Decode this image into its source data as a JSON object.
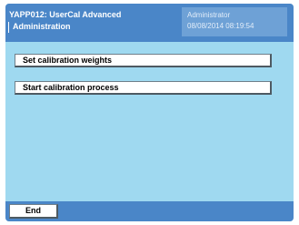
{
  "header": {
    "title_line1": "YAPP012: UserCal Advanced",
    "title_line2": "Administration",
    "user": "Administrator",
    "datetime": "08/08/2014 08:19:54"
  },
  "menu": {
    "items": [
      {
        "label": "Set calibration weights"
      },
      {
        "label": "Start calibration process"
      }
    ]
  },
  "footer": {
    "end_label": "End"
  },
  "colors": {
    "background": "#9fd9f0",
    "header": "#4a86c8",
    "user_box": "#6ea1d6",
    "button": "#ffffff"
  }
}
